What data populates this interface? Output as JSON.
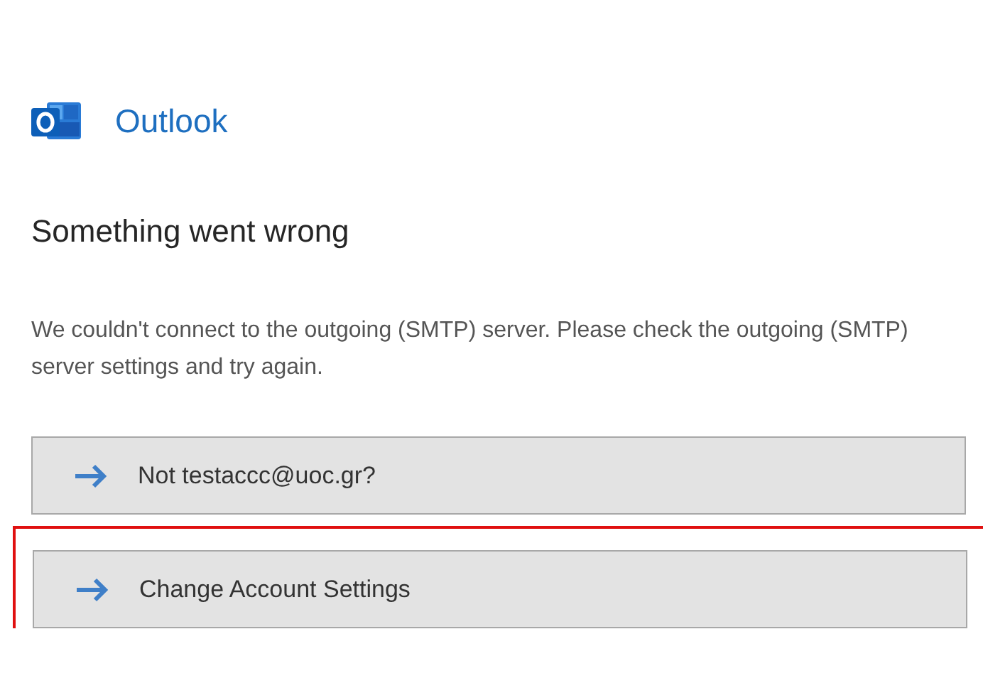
{
  "app": {
    "name": "Outlook"
  },
  "heading": "Something went wrong",
  "message": "We couldn't connect to the outgoing (SMTP) server. Please check the outgoing (SMTP) server settings and try again.",
  "actions": [
    {
      "label": "Not testaccc@uoc.gr?",
      "highlighted": false
    },
    {
      "label": "Change Account Settings",
      "highlighted": true
    }
  ]
}
